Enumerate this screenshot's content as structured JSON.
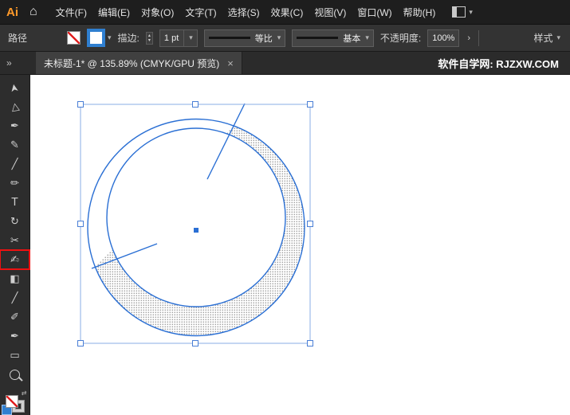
{
  "menu_bar": {
    "logo": "Ai",
    "items": [
      "文件(F)",
      "编辑(E)",
      "对象(O)",
      "文字(T)",
      "选择(S)",
      "效果(C)",
      "视图(V)",
      "窗口(W)",
      "帮助(H)"
    ]
  },
  "control_bar": {
    "selection_label": "路径",
    "stroke_label": "描边:",
    "stroke_width_value": "1 pt",
    "width_profile_value": "等比",
    "brush_definition_value": "基本",
    "opacity_label": "不透明度:",
    "opacity_value": "100%",
    "style_label": "样式"
  },
  "tab_bar": {
    "document_title": "未标题-1* @ 135.89% (CMYK/GPU 预览)",
    "watermark": "软件自学网: RJZXW.COM"
  },
  "toolbar": {
    "tools": [
      {
        "name": "selection-tool",
        "glyph": "➤"
      },
      {
        "name": "direct-selection-tool",
        "glyph": "▷"
      },
      {
        "name": "pen-tool",
        "glyph": "✒"
      },
      {
        "name": "curvature-tool",
        "glyph": "✎"
      },
      {
        "name": "line-segment-tool",
        "glyph": "╱"
      },
      {
        "name": "paintbrush-tool",
        "glyph": "✏"
      },
      {
        "name": "type-tool",
        "glyph": "T"
      },
      {
        "name": "rotate-tool",
        "glyph": "↻"
      },
      {
        "name": "scissors-tool",
        "glyph": "✂"
      },
      {
        "name": "shaper-tool",
        "glyph": "✍",
        "highlighted": true
      },
      {
        "name": "gradient-tool",
        "glyph": "◧"
      },
      {
        "name": "knife-tool",
        "glyph": "╱"
      },
      {
        "name": "blob-brush-tool",
        "glyph": "✐"
      },
      {
        "name": "eyedropper-tool",
        "glyph": "✒"
      },
      {
        "name": "artboard-tool",
        "glyph": "▭"
      },
      {
        "name": "zoom-tool",
        "glyph": ""
      }
    ]
  },
  "icons": {
    "home": "⌂",
    "caret_down": "▾",
    "spinner_up": "▴",
    "spinner_down": "▾",
    "expand_arrow": "›",
    "collapse": "»",
    "close": "×",
    "swap": "⇄"
  },
  "colors": {
    "selection_blue": "#2a6fd4",
    "tool_highlight_red": "#ee1111",
    "logo_orange": "#ff9a2a",
    "stroke_swatch_blue": "#2f7fd0"
  }
}
